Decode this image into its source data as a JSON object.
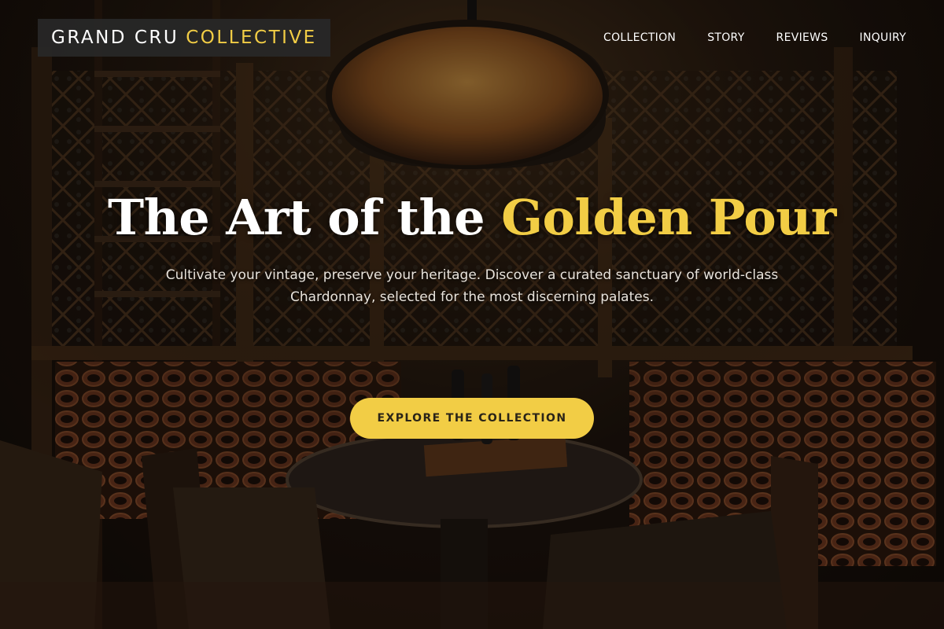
{
  "brand": {
    "name_white": "GRAND CRU",
    "name_gold": "COLLECTIVE"
  },
  "nav": [
    "COLLECTION",
    "STORY",
    "REVIEWS",
    "INQUIRY"
  ],
  "hero": {
    "headline_white": "The Art of the ",
    "headline_gold": "Golden Pour",
    "subtext": "Cultivate your vintage, preserve your heritage. Discover a curated sanctuary of world-class Chardonnay, selected for the most discerning palates.",
    "cta_label": "EXPLORE THE COLLECTION"
  },
  "colors": {
    "accent": "#f2cd45",
    "text": "#ffffff",
    "logo_bg": "#282828"
  }
}
